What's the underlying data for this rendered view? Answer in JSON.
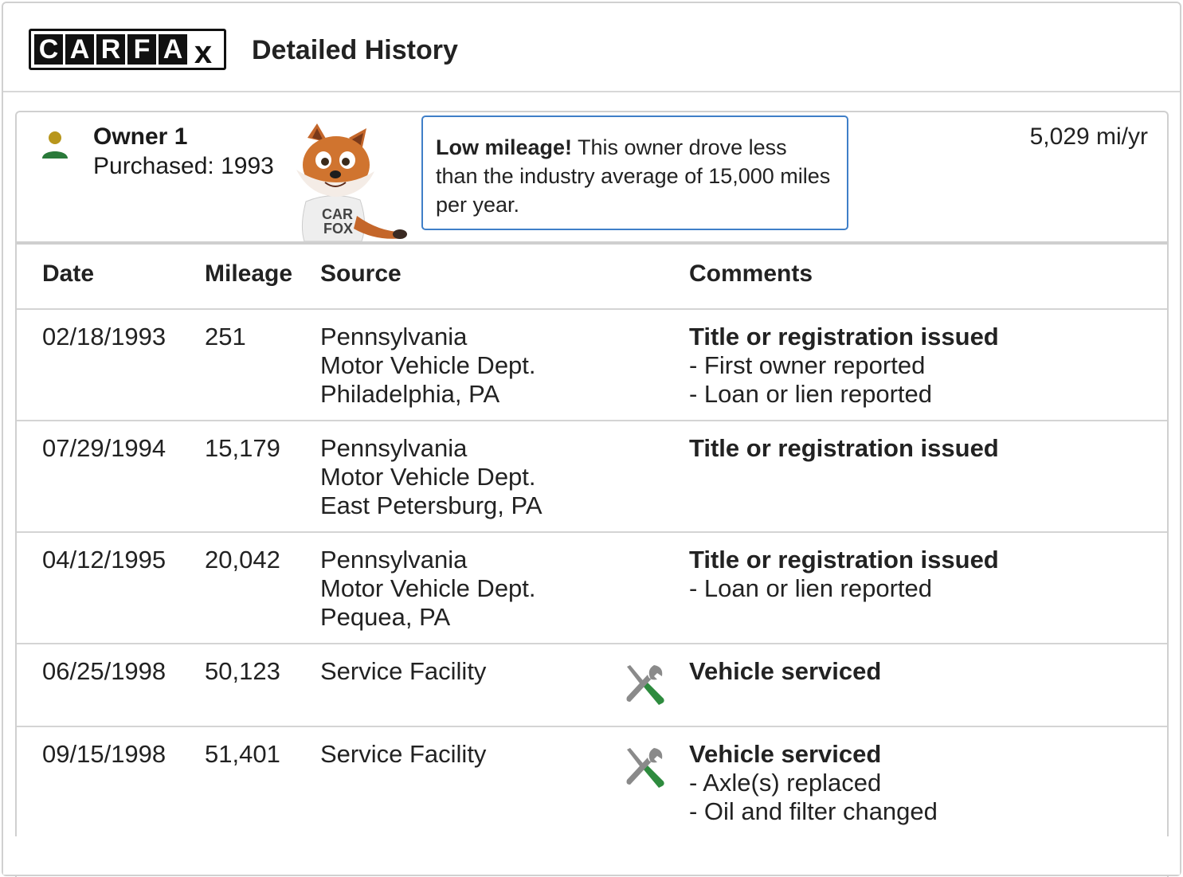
{
  "header": {
    "logo_letters": [
      "C",
      "A",
      "R",
      "F",
      "A",
      "X"
    ],
    "title": "Detailed History"
  },
  "owner": {
    "name": "Owner 1",
    "purchased": "Purchased: 1993",
    "callout_bold": "Low mileage!",
    "callout_text": " This owner drove less than the industry average of 15,000 miles per year.",
    "miles_per_year": "5,029 mi/yr",
    "fox_shirt_text": "CAR FOX"
  },
  "table": {
    "headers": {
      "date": "Date",
      "mileage": "Mileage",
      "source": "Source",
      "comments": "Comments"
    },
    "rows": [
      {
        "date": "02/18/1993",
        "mileage": "251",
        "source": [
          "Pennsylvania",
          "Motor Vehicle Dept.",
          "Philadelphia, PA"
        ],
        "icon": "",
        "comment_title": "Title or registration issued",
        "comment_items": [
          "- First owner reported",
          "- Loan or lien reported"
        ]
      },
      {
        "date": "07/29/1994",
        "mileage": "15,179",
        "source": [
          "Pennsylvania",
          "Motor Vehicle Dept.",
          "East Petersburg, PA"
        ],
        "icon": "",
        "comment_title": "Title or registration issued",
        "comment_items": []
      },
      {
        "date": "04/12/1995",
        "mileage": "20,042",
        "source": [
          "Pennsylvania",
          "Motor Vehicle Dept.",
          "Pequea, PA"
        ],
        "icon": "",
        "comment_title": "Title or registration issued",
        "comment_items": [
          "- Loan or lien reported"
        ]
      },
      {
        "date": "06/25/1998",
        "mileage": "50,123",
        "source": [
          "Service Facility"
        ],
        "icon": "service-tools-icon",
        "comment_title": "Vehicle serviced",
        "comment_items": []
      },
      {
        "date": "09/15/1998",
        "mileage": "51,401",
        "source": [
          "Service Facility"
        ],
        "icon": "service-tools-icon",
        "comment_title": "Vehicle serviced",
        "comment_items": [
          "- Axle(s) replaced",
          "- Oil and filter changed"
        ]
      }
    ]
  },
  "colors": {
    "owner_head": "#b8961c",
    "owner_body": "#2a7a3a",
    "callout_border": "#3f7fc8",
    "tool_handle": "#2e8b3e",
    "tool_metal": "#8a8a8a"
  }
}
